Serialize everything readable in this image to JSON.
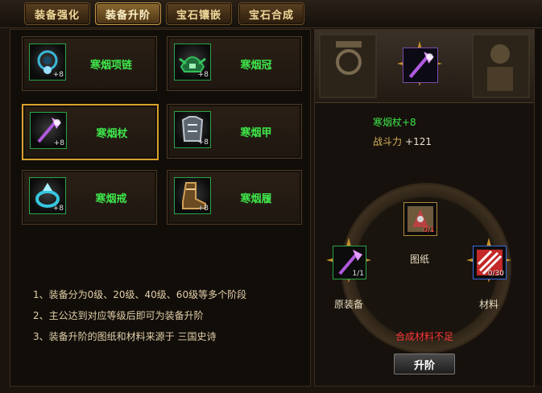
{
  "tabs": [
    {
      "label": "装备强化"
    },
    {
      "label": "装备升阶"
    },
    {
      "label": "宝石镶嵌"
    },
    {
      "label": "宝石合成"
    }
  ],
  "equipment": [
    {
      "name": "寒烟项链",
      "level": "+8",
      "icon": "necklace-icon",
      "color": "#3ab7d8"
    },
    {
      "name": "寒烟冠",
      "level": "+8",
      "icon": "helmet-icon",
      "color": "#35c05a"
    },
    {
      "name": "寒烟杖",
      "level": "+8",
      "icon": "staff-icon",
      "color": "#b05adf"
    },
    {
      "name": "寒烟甲",
      "level": "+8",
      "icon": "armor-icon",
      "color": "#bcc3cc"
    },
    {
      "name": "寒烟戒",
      "level": "+8",
      "icon": "ring-icon",
      "color": "#38c6e0"
    },
    {
      "name": "寒烟履",
      "level": "+8",
      "icon": "boots-icon",
      "color": "#d2a056"
    }
  ],
  "notes": [
    "1、装备分为0级、20级、40级、60级等多个阶段",
    "2、主公达到对应等级后即可为装备升阶",
    "3、装备升阶的图纸和材料来源于 三国史诗"
  ],
  "preview": {
    "name": "寒烟杖+8",
    "power_label": "战斗力",
    "power_value": "+121"
  },
  "materials": {
    "blueprint": {
      "label": "图纸",
      "count": "0/1",
      "icon": "blueprint-icon"
    },
    "original": {
      "label": "原装备",
      "count": "1/1",
      "icon": "staff-icon"
    },
    "material": {
      "label": "材料",
      "count": "0/30",
      "icon": "material-icon"
    }
  },
  "warning": "合成材料不足",
  "upgrade_button": "升阶"
}
